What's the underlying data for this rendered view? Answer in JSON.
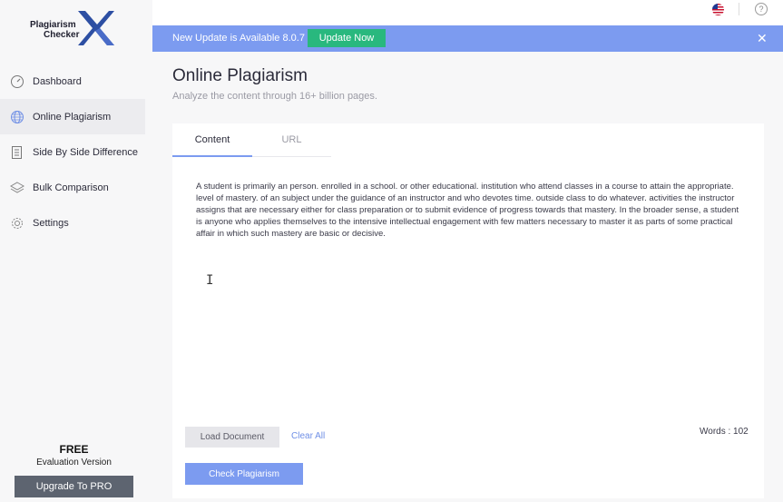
{
  "logo": {
    "line1": "Plagiarism",
    "line2": "Checker"
  },
  "sidebar": {
    "items": [
      {
        "label": "Dashboard",
        "icon": "gauge-icon"
      },
      {
        "label": "Online Plagiarism",
        "icon": "globe-icon"
      },
      {
        "label": "Side By Side Difference",
        "icon": "document-icon"
      },
      {
        "label": "Bulk Comparison",
        "icon": "layers-icon"
      },
      {
        "label": "Settings",
        "icon": "gear-icon"
      }
    ],
    "active_index": 1
  },
  "license": {
    "title": "FREE",
    "subtitle": "Evaluation Version",
    "upgrade_label": "Upgrade To PRO"
  },
  "topbar": {
    "help_glyph": "?"
  },
  "banner": {
    "text": "New Update is Available 8.0.7",
    "button_label": "Update Now",
    "close_glyph": "✕"
  },
  "page": {
    "title": "Online Plagiarism",
    "subtitle": "Analyze the content through 16+ billion pages."
  },
  "tabs": [
    {
      "label": "Content",
      "active": true
    },
    {
      "label": "URL",
      "active": false
    }
  ],
  "content": {
    "text": "A student is primarily an person. enrolled in a school. or other educational. institution who attend classes in a course to attain the appropriate. level of mastery. of an subject under the guidance of an instructor and who devotes time. outside class to do whatever. activities the instructor assigns that are necessary either for class preparation or to submit evidence of progress towards that mastery. In the broader sense, a student is anyone who applies themselves to the intensive intellectual engagement with few matters necessary to master it as parts of some practical affair in which such mastery are basic or decisive."
  },
  "actions": {
    "load_label": "Load Document",
    "clear_label": "Clear All",
    "words_label": "Words : 102",
    "check_label": "Check Plagiarism"
  },
  "colors": {
    "accent": "#7c9bf0",
    "update_green": "#29b87e",
    "upgrade_gray": "#5d6470"
  }
}
